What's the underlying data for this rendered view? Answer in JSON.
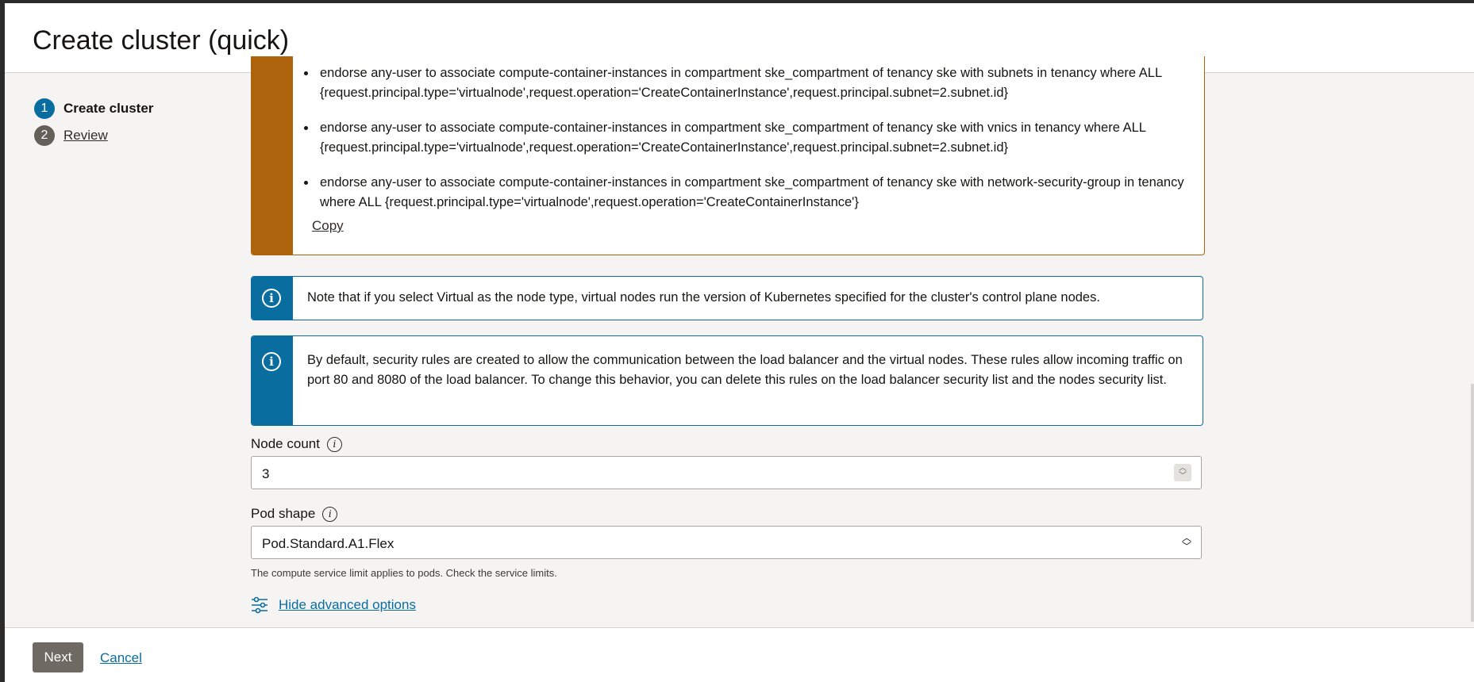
{
  "header": {
    "title": "Create cluster (quick)"
  },
  "steps": [
    {
      "number": "1",
      "label": "Create cluster"
    },
    {
      "number": "2",
      "label": "Review"
    }
  ],
  "warning": {
    "items": [
      "endorse any-user to associate compute-container-instances in compartment ske_compartment of tenancy ske with subnets in tenancy where ALL {request.principal.type='virtualnode',request.operation='CreateContainerInstance',request.principal.subnet=2.subnet.id}",
      "endorse any-user to associate compute-container-instances in compartment ske_compartment of tenancy ske with vnics in tenancy where ALL {request.principal.type='virtualnode',request.operation='CreateContainerInstance',request.principal.subnet=2.subnet.id}",
      "endorse any-user to associate compute-container-instances in compartment ske_compartment of tenancy ske with network-security-group in tenancy where ALL {request.principal.type='virtualnode',request.operation='CreateContainerInstance'}"
    ],
    "copy_label": "Copy"
  },
  "info_messages": [
    "Note that if you select Virtual as the node type, virtual nodes run the version of Kubernetes specified for the cluster's control plane nodes.",
    "By default, security rules are created to allow the communication between the load balancer and the virtual nodes. These rules allow incoming traffic on port 80 and 8080 of the load balancer. To change this behavior, you can delete this rules on the load balancer security list and the nodes security list."
  ],
  "node_count": {
    "label": "Node count",
    "value": "3"
  },
  "pod_shape": {
    "label": "Pod shape",
    "value": "Pod.Standard.A1.Flex",
    "helper": "The compute service limit applies to pods. Check the service limits."
  },
  "advanced": {
    "label": "Hide advanced options"
  },
  "footer": {
    "next_label": "Next",
    "cancel_label": "Cancel"
  },
  "colors": {
    "primary": "#0a6da0",
    "warning": "#ac630c",
    "button": "#6f6964"
  }
}
